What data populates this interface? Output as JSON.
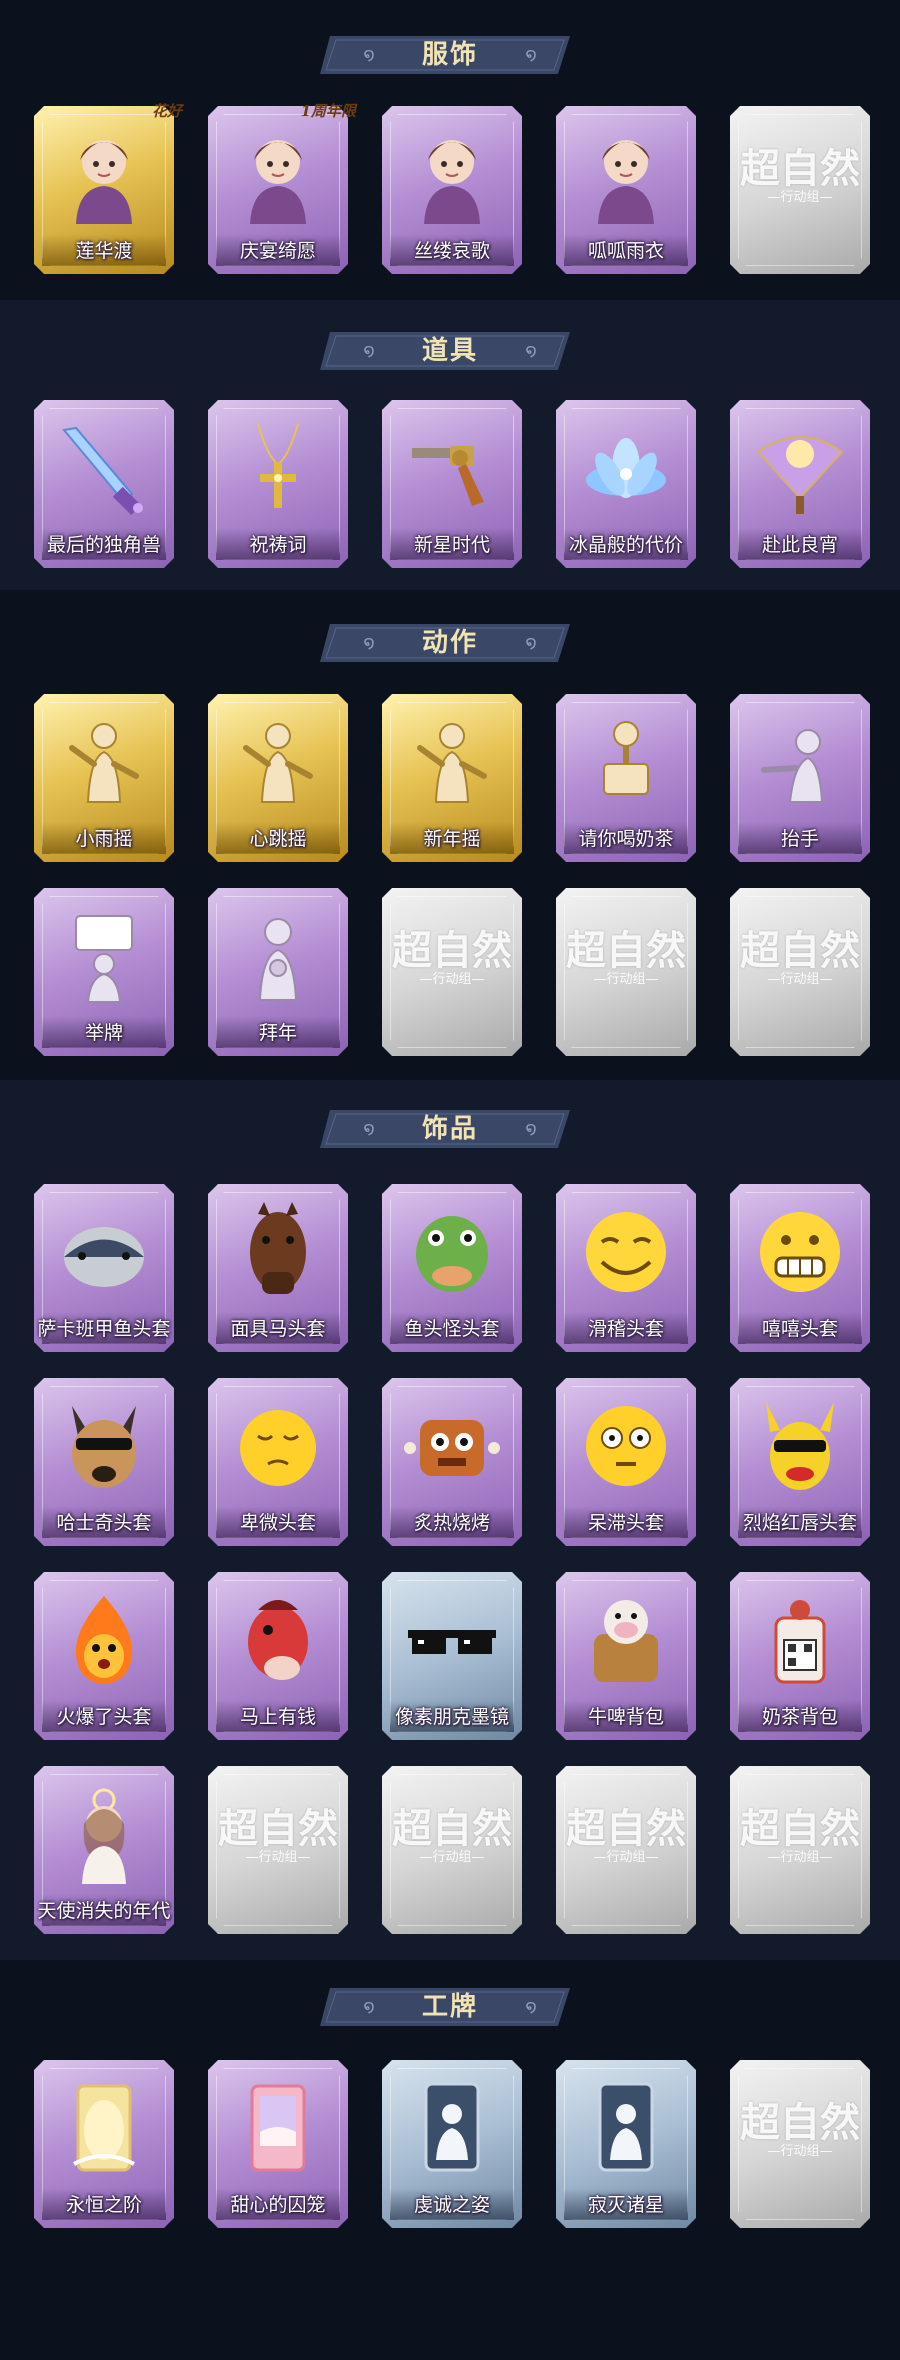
{
  "colors": {
    "background": "#0d1422",
    "banner": "#3a4766",
    "banner_text": "#f2e3b4",
    "purple_card": "#b58fd4",
    "gold_card": "#e6c253",
    "grey_card": "#d6d6d6",
    "blue_card": "#a9bed3"
  },
  "watermark": {
    "main": "超自然",
    "sub": "—行动组—"
  },
  "sections": {
    "costumes": {
      "title": "服饰",
      "items": [
        {
          "label": "莲华渡",
          "style": "gold",
          "icon": "costume-portrait-icon",
          "tag": "花好"
        },
        {
          "label": "庆宴绮愿",
          "style": "purple",
          "icon": "costume-portrait-icon",
          "tag": "1周年限"
        },
        {
          "label": "丝缕哀歌",
          "style": "purple",
          "icon": "costume-portrait-icon"
        },
        {
          "label": "呱呱雨衣",
          "style": "purple",
          "icon": "costume-portrait-icon"
        },
        {
          "label": "",
          "style": "grey",
          "icon": "placeholder-watermark-icon"
        }
      ]
    },
    "props": {
      "title": "道具",
      "items": [
        {
          "label": "最后的独角兽",
          "style": "purple",
          "icon": "crystal-dagger-icon"
        },
        {
          "label": "祝祷词",
          "style": "purple",
          "icon": "cross-necklace-icon"
        },
        {
          "label": "新星时代",
          "style": "purple",
          "icon": "revolver-icon"
        },
        {
          "label": "冰晶般的代价",
          "style": "purple",
          "icon": "ice-lotus-icon"
        },
        {
          "label": "赴此良宵",
          "style": "purple",
          "icon": "folding-fan-icon"
        }
      ]
    },
    "actions": {
      "title": "动作",
      "items": [
        {
          "label": "小雨摇",
          "style": "gold",
          "icon": "dance-pose-icon"
        },
        {
          "label": "心跳摇",
          "style": "gold",
          "icon": "dance-pose-icon"
        },
        {
          "label": "新年摇",
          "style": "gold",
          "icon": "dance-pose-icon"
        },
        {
          "label": "请你喝奶茶",
          "style": "purple",
          "icon": "milk-tea-pose-icon"
        },
        {
          "label": "抬手",
          "style": "purple",
          "icon": "raise-hand-pose-icon"
        },
        {
          "label": "举牌",
          "style": "purple",
          "icon": "hold-sign-pose-icon"
        },
        {
          "label": "拜年",
          "style": "purple",
          "icon": "new-year-greeting-pose-icon"
        },
        {
          "label": "",
          "style": "grey",
          "icon": "placeholder-watermark-icon"
        },
        {
          "label": "",
          "style": "grey",
          "icon": "placeholder-watermark-icon"
        },
        {
          "label": "",
          "style": "grey",
          "icon": "placeholder-watermark-icon"
        }
      ]
    },
    "accessories": {
      "title": "饰品",
      "items": [
        {
          "label": "萨卡班甲鱼头套",
          "style": "purple",
          "icon": "fish-mask-icon"
        },
        {
          "label": "面具马头套",
          "style": "purple",
          "icon": "horse-mask-icon"
        },
        {
          "label": "鱼头怪头套",
          "style": "purple",
          "icon": "green-fish-mask-icon"
        },
        {
          "label": "滑稽头套",
          "style": "purple",
          "icon": "funny-face-mask-icon"
        },
        {
          "label": "嘻嘻头套",
          "style": "purple",
          "icon": "grin-face-mask-icon"
        },
        {
          "label": "哈士奇头套",
          "style": "purple",
          "icon": "husky-mask-icon"
        },
        {
          "label": "卑微头套",
          "style": "purple",
          "icon": "humble-face-mask-icon"
        },
        {
          "label": "炙热烧烤",
          "style": "purple",
          "icon": "bbq-mask-icon"
        },
        {
          "label": "呆滞头套",
          "style": "purple",
          "icon": "dazed-face-mask-icon"
        },
        {
          "label": "烈焰红唇头套",
          "style": "purple",
          "icon": "red-lips-mask-icon"
        },
        {
          "label": "火爆了头套",
          "style": "purple",
          "icon": "fire-mask-icon"
        },
        {
          "label": "马上有钱",
          "style": "purple",
          "icon": "red-horse-mask-icon"
        },
        {
          "label": "像素朋克墨镜",
          "style": "blue",
          "icon": "pixel-sunglasses-icon"
        },
        {
          "label": "牛啤背包",
          "style": "purple",
          "icon": "cow-backpack-icon"
        },
        {
          "label": "奶茶背包",
          "style": "purple",
          "icon": "milk-tea-backpack-icon"
        },
        {
          "label": "天使消失的年代",
          "style": "purple",
          "icon": "angel-doll-icon"
        },
        {
          "label": "",
          "style": "grey",
          "icon": "placeholder-watermark-icon"
        },
        {
          "label": "",
          "style": "grey",
          "icon": "placeholder-watermark-icon"
        },
        {
          "label": "",
          "style": "grey",
          "icon": "placeholder-watermark-icon"
        },
        {
          "label": "",
          "style": "grey",
          "icon": "placeholder-watermark-icon"
        }
      ]
    },
    "badges": {
      "title": "工牌",
      "items": [
        {
          "label": "永恒之阶",
          "style": "purple",
          "icon": "golden-badge-icon"
        },
        {
          "label": "甜心的囚笼",
          "style": "purple",
          "icon": "pink-badge-icon"
        },
        {
          "label": "虔诚之姿",
          "style": "blue",
          "icon": "silhouette-badge-icon"
        },
        {
          "label": "寂灭诸星",
          "style": "blue",
          "icon": "silhouette-badge-icon"
        },
        {
          "label": "",
          "style": "grey",
          "icon": "placeholder-watermark-icon"
        }
      ]
    }
  }
}
